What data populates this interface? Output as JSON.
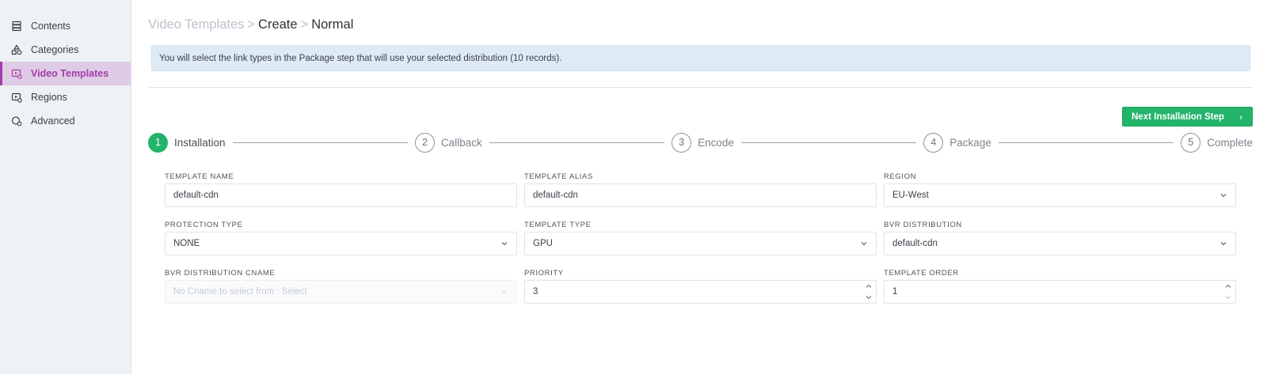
{
  "sidebar": {
    "items": [
      {
        "label": "Contents",
        "icon": "database-icon"
      },
      {
        "label": "Categories",
        "icon": "shapes-icon"
      },
      {
        "label": "Video Templates",
        "icon": "video-template-icon"
      },
      {
        "label": "Regions",
        "icon": "region-icon"
      },
      {
        "label": "Advanced",
        "icon": "advanced-icon"
      }
    ],
    "active_index": 2
  },
  "breadcrumb": {
    "root": "Video Templates",
    "separator": ">",
    "step": "Create",
    "current": "Normal"
  },
  "info_banner": "You will select the link types in the Package step that will use your selected distribution (10 records).",
  "next_button": {
    "label": "Next Installation Step",
    "icon": "chevron-right-icon"
  },
  "stepper": [
    {
      "number": "1",
      "label": "Installation",
      "active": true
    },
    {
      "number": "2",
      "label": "Callback",
      "active": false
    },
    {
      "number": "3",
      "label": "Encode",
      "active": false
    },
    {
      "number": "4",
      "label": "Package",
      "active": false
    },
    {
      "number": "5",
      "label": "Complete",
      "active": false
    }
  ],
  "form": {
    "template_name": {
      "label": "TEMPLATE NAME",
      "value": "default-cdn"
    },
    "template_alias": {
      "label": "TEMPLATE ALIAS",
      "value": "default-cdn"
    },
    "region": {
      "label": "REGION",
      "value": "EU-West"
    },
    "protection_type": {
      "label": "PROTECTION TYPE",
      "value": "NONE"
    },
    "template_type": {
      "label": "TEMPLATE TYPE",
      "value": "GPU"
    },
    "bvr_distribution": {
      "label": "BVR DISTRIBUTION",
      "value": "default-cdn"
    },
    "bvr_distribution_cname": {
      "label": "BVR DISTRIBUTION CNAME",
      "placeholder": "No Cname to select from : Select"
    },
    "priority": {
      "label": "PRIORITY",
      "value": "3"
    },
    "template_order": {
      "label": "TEMPLATE ORDER",
      "value": "1"
    }
  },
  "colors": {
    "accent": "#a33ba8",
    "success": "#23b46a",
    "banner_bg": "#deebf5",
    "sidebar_bg": "#eef1f5"
  }
}
